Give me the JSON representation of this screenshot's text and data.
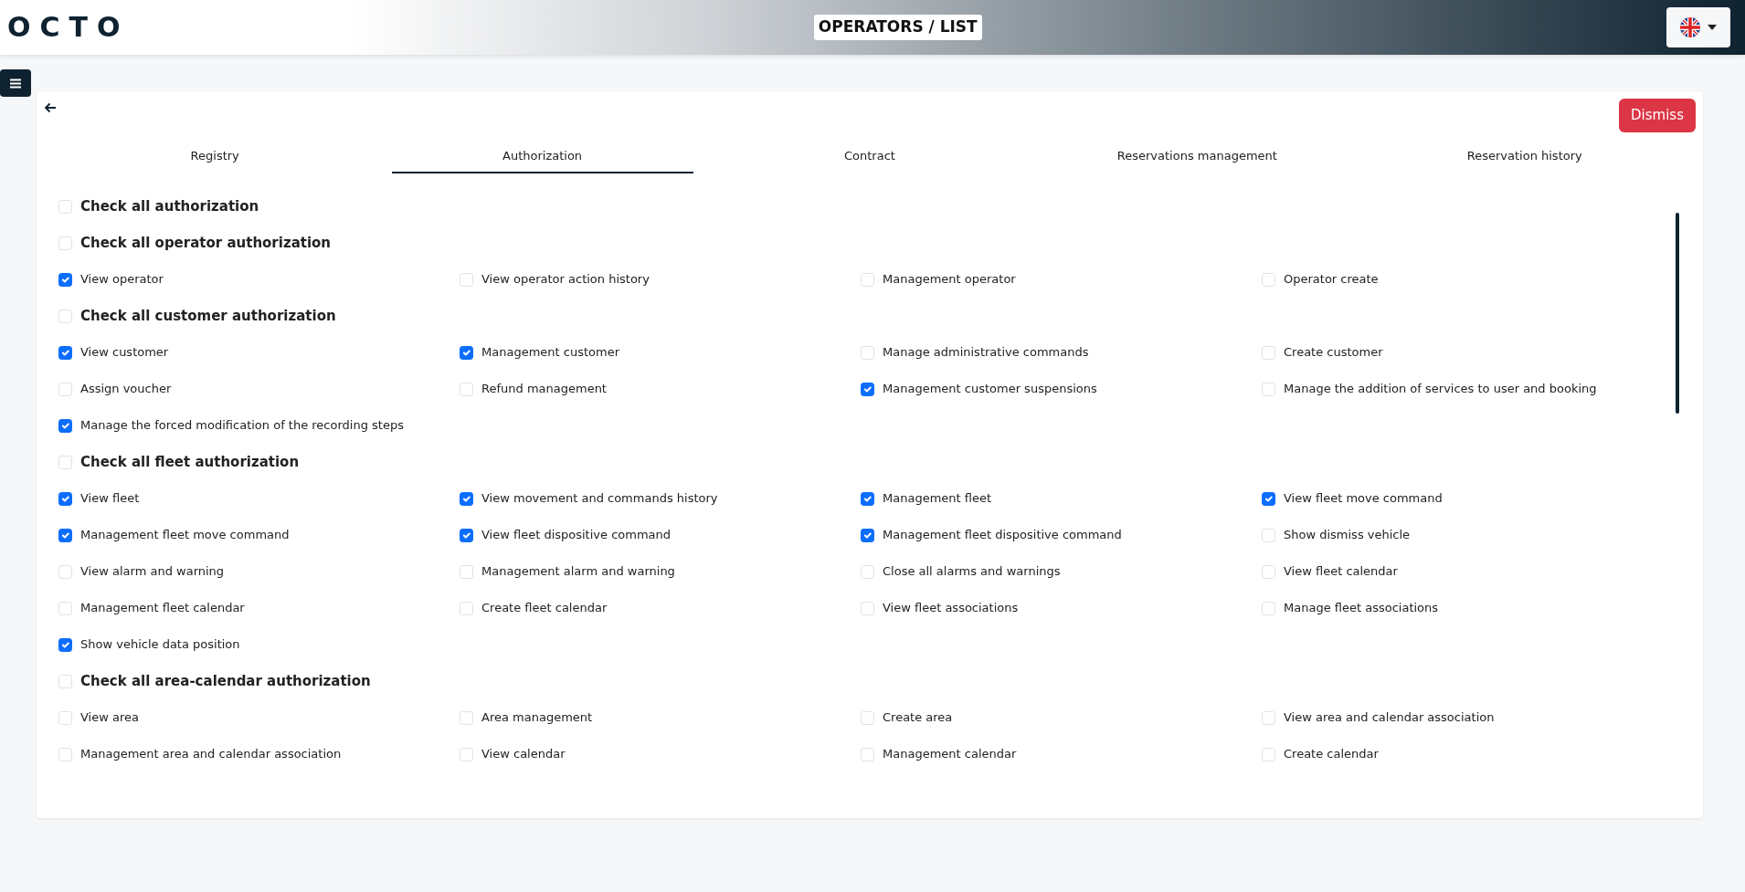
{
  "header": {
    "logo": "OCTO",
    "title": "OPERATORS / LIST"
  },
  "dismiss_button": "Dismiss",
  "tabs": [
    {
      "label": "Registry",
      "selected": false
    },
    {
      "label": "Authorization",
      "selected": true
    },
    {
      "label": "Contract",
      "selected": false
    },
    {
      "label": "Reservations management",
      "selected": false
    },
    {
      "label": "Reservation history",
      "selected": false
    }
  ],
  "check_all": {
    "label": "Check all authorization",
    "checked": false
  },
  "sections": [
    {
      "label": "Check all operator authorization",
      "checked": false,
      "items": [
        {
          "label": "View operator",
          "checked": true
        },
        {
          "label": "View operator action history",
          "checked": false
        },
        {
          "label": "Management operator",
          "checked": false
        },
        {
          "label": "Operator create",
          "checked": false
        }
      ]
    },
    {
      "label": "Check all customer authorization",
      "checked": false,
      "items": [
        {
          "label": "View customer",
          "checked": true
        },
        {
          "label": "Management customer",
          "checked": true
        },
        {
          "label": "Manage administrative commands",
          "checked": false
        },
        {
          "label": "Create customer",
          "checked": false
        },
        {
          "label": "Assign voucher",
          "checked": false
        },
        {
          "label": "Refund management",
          "checked": false
        },
        {
          "label": "Management customer suspensions",
          "checked": true
        },
        {
          "label": "Manage the addition of services to user and booking",
          "checked": false
        },
        {
          "label": "Manage the forced modification of the recording steps",
          "checked": true
        }
      ]
    },
    {
      "label": "Check all fleet authorization",
      "checked": false,
      "items": [
        {
          "label": "View fleet",
          "checked": true
        },
        {
          "label": "View movement and commands history",
          "checked": true
        },
        {
          "label": "Management fleet",
          "checked": true
        },
        {
          "label": "View fleet move command",
          "checked": true
        },
        {
          "label": "Management fleet move command",
          "checked": true
        },
        {
          "label": "View fleet dispositive command",
          "checked": true
        },
        {
          "label": "Management fleet dispositive command",
          "checked": true
        },
        {
          "label": "Show dismiss vehicle",
          "checked": false
        },
        {
          "label": "View alarm and warning",
          "checked": false
        },
        {
          "label": "Management alarm and warning",
          "checked": false
        },
        {
          "label": "Close all alarms and warnings",
          "checked": false
        },
        {
          "label": "View fleet calendar",
          "checked": false
        },
        {
          "label": "Management fleet calendar",
          "checked": false
        },
        {
          "label": "Create fleet calendar",
          "checked": false
        },
        {
          "label": "View fleet associations",
          "checked": false
        },
        {
          "label": "Manage fleet associations",
          "checked": false
        },
        {
          "label": "Show vehicle data position",
          "checked": true
        }
      ]
    },
    {
      "label": "Check all area-calendar authorization",
      "checked": false,
      "items": [
        {
          "label": "View area",
          "checked": false
        },
        {
          "label": "Area management",
          "checked": false
        },
        {
          "label": "Create area",
          "checked": false
        },
        {
          "label": "View area and calendar association",
          "checked": false
        },
        {
          "label": "Management area and calendar association",
          "checked": false
        },
        {
          "label": "View calendar",
          "checked": false
        },
        {
          "label": "Management calendar",
          "checked": false
        },
        {
          "label": "Create calendar",
          "checked": false
        }
      ]
    }
  ]
}
